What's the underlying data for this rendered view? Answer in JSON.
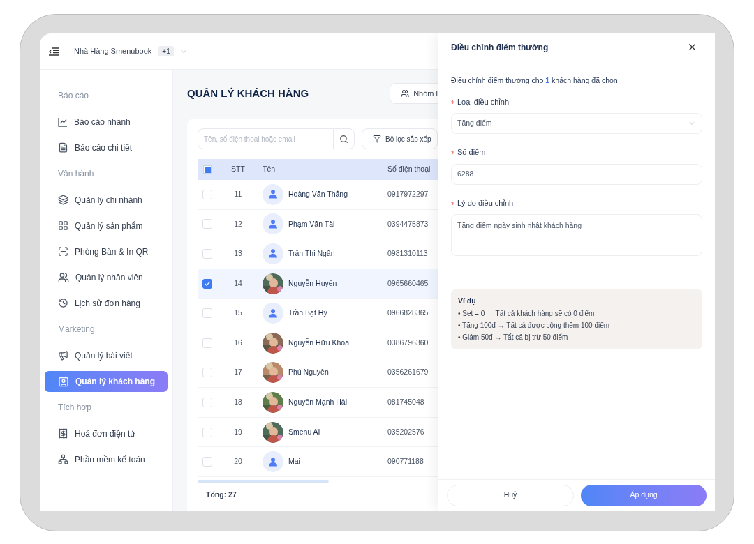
{
  "header": {
    "restaurant": "Nhà Hàng Smenubook",
    "badge": "+1"
  },
  "sidebar": {
    "sections": [
      {
        "title": "Báo cáo",
        "items": [
          {
            "label": "Báo cáo nhanh",
            "selected": false
          },
          {
            "label": "Báo cáo chi tiết",
            "selected": false
          }
        ]
      },
      {
        "title": "Vận hành",
        "items": [
          {
            "label": "Quản lý chi nhánh",
            "selected": false
          },
          {
            "label": "Quản lý sản phẩm",
            "selected": false
          },
          {
            "label": "Phòng Bàn & In QR",
            "selected": false
          },
          {
            "label": "Quản lý nhân viên",
            "selected": false
          },
          {
            "label": "Lịch sử đơn hàng",
            "selected": false
          }
        ]
      },
      {
        "title": "Marketing",
        "items": [
          {
            "label": "Quản lý bài viết",
            "selected": false
          },
          {
            "label": "Quản lý khách hàng",
            "selected": true
          }
        ]
      },
      {
        "title": "Tích hợp",
        "items": [
          {
            "label": "Hoá đơn điện tử",
            "selected": false
          },
          {
            "label": "Phần mềm kế toán",
            "selected": false
          }
        ]
      }
    ]
  },
  "page": {
    "title": "QUẢN LÝ KHÁCH HÀNG",
    "group_button": "Nhóm l"
  },
  "search": {
    "placeholder": "Tên, số điện thoại hoặc email"
  },
  "filter_button": "Bộ lọc sắp xếp",
  "table": {
    "select_all": {
      "indeterminate": true
    },
    "columns": [
      "STT",
      "Tên",
      "Số điện thoại"
    ],
    "rows": [
      {
        "stt": "11",
        "name": "Hoàng Văn Thắng",
        "phone": "0917972297",
        "kind": "default",
        "selected": false
      },
      {
        "stt": "12",
        "name": "Phạm Văn Tài",
        "phone": "0394475873",
        "kind": "default",
        "selected": false
      },
      {
        "stt": "13",
        "name": "Trần Thị Ngân",
        "phone": "0981310113",
        "kind": "default",
        "selected": false
      },
      {
        "stt": "14",
        "name": "Nguyễn Huyền",
        "phone": "0965660465",
        "selected": true
      },
      {
        "stt": "15",
        "name": "Trần Bạt Hý",
        "phone": "0966828365",
        "kind": "default",
        "selected": false
      },
      {
        "stt": "16",
        "name": "Nguyễn Hữu Khoa",
        "phone": "0386796360",
        "selected": false
      },
      {
        "stt": "17",
        "name": "Phú Nguyễn",
        "phone": "0356261679",
        "selected": false
      },
      {
        "stt": "18",
        "name": "Nguyễn Mạnh Hải",
        "phone": "081745048",
        "selected": false
      },
      {
        "stt": "19",
        "name": "Smenu AI",
        "phone": "035202576",
        "selected": false
      },
      {
        "stt": "20",
        "name": "Mai",
        "phone": "090771188",
        "kind": "default",
        "selected": false
      }
    ],
    "total": "Tổng: 27"
  },
  "drawer": {
    "title": "Điều chỉnh điểm thưởng",
    "intro": {
      "before": "Điều chỉnh điểm thưởng cho",
      "count": "1",
      "after": "khách hàng đã chọn"
    },
    "fields": [
      {
        "kind": "select",
        "label": "Loại điều chỉnh",
        "required": true,
        "value": "Tăng điểm"
      },
      {
        "kind": "input",
        "label": "Số điểm",
        "required": true,
        "value": "6288"
      },
      {
        "kind": "textarea",
        "label": "Lý do điều chỉnh",
        "required": true,
        "value": "Tặng điểm ngày sinh nhật khách hàng"
      }
    ],
    "example": {
      "title": "Ví dụ",
      "lines": [
        "• Set = 0 → Tất cả khách hàng sẽ có 0 điểm",
        "• Tăng 100đ → Tất cả được cộng thêm 100 điểm",
        "• Giảm 50đ → Tất cả bị trừ 50 điểm"
      ]
    },
    "cancel": "Huỷ",
    "apply": "Áp dụng"
  }
}
